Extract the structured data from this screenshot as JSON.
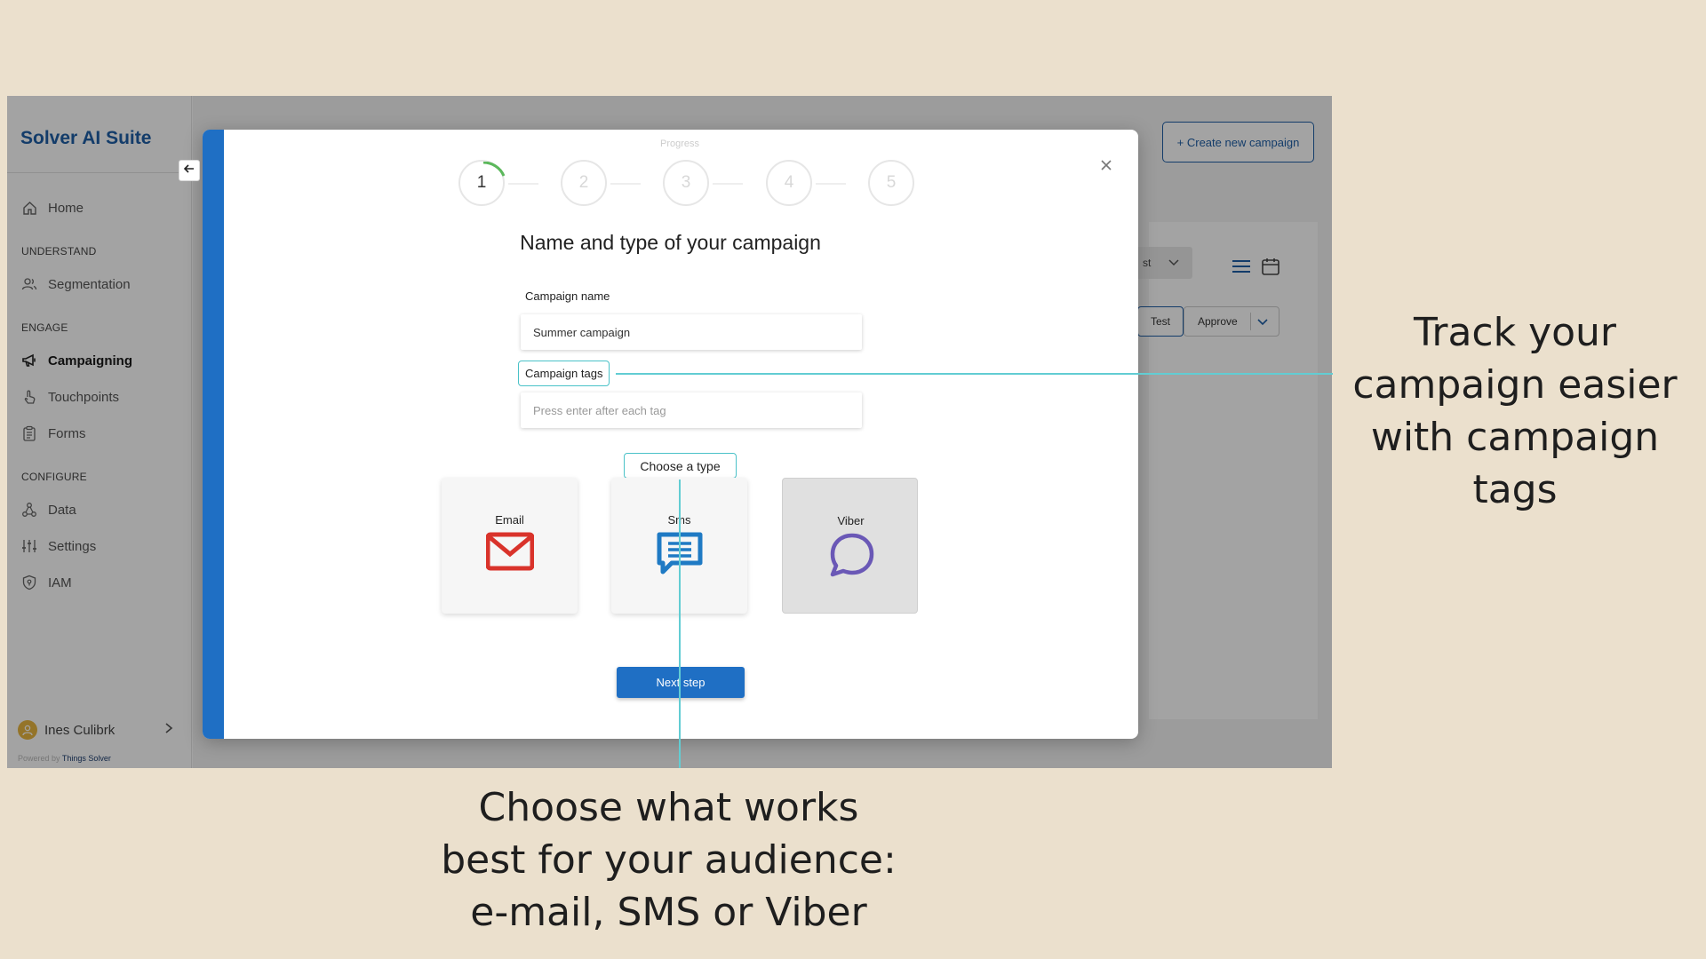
{
  "app": {
    "brand": "Solver AI Suite",
    "create_button": "+ Create new campaign"
  },
  "sidebar": {
    "items": [
      {
        "label": "Home",
        "icon": "home-icon"
      },
      {
        "label": "Segmentation",
        "icon": "users-icon"
      },
      {
        "label": "Campaigning",
        "icon": "megaphone-icon"
      },
      {
        "label": "Touchpoints",
        "icon": "touch-icon"
      },
      {
        "label": "Forms",
        "icon": "clipboard-icon"
      },
      {
        "label": "Data",
        "icon": "data-nodes-icon"
      },
      {
        "label": "Settings",
        "icon": "sliders-icon"
      },
      {
        "label": "IAM",
        "icon": "shield-icon"
      }
    ],
    "sections": [
      "UNDERSTAND",
      "ENGAGE",
      "CONFIGURE"
    ],
    "active_item": "Campaigning",
    "user_name": "Ines Culibrk",
    "powered_by_prefix": "Powered by",
    "powered_by_name": "Things Solver"
  },
  "background_toolbar": {
    "sort_label": "st",
    "test_label": "Test",
    "approve_label": "Approve"
  },
  "modal": {
    "progress_label": "Progress",
    "steps": [
      "1",
      "2",
      "3",
      "4",
      "5"
    ],
    "current_step": 1,
    "title": "Name and type of your campaign",
    "campaign_name_label": "Campaign name",
    "campaign_name_value": "Summer campaign",
    "campaign_tags_label": "Campaign tags",
    "campaign_tags_placeholder": "Press enter after each tag",
    "choose_type_label": "Choose a type",
    "types": [
      {
        "label": "Email",
        "icon": "envelope-icon",
        "color": "#d9332b"
      },
      {
        "label": "Sms",
        "icon": "chat-icon",
        "color": "#1f7ac4"
      },
      {
        "label": "Viber",
        "icon": "viber-bubble-icon",
        "color": "#6a58b6"
      }
    ],
    "selected_type": "Viber",
    "next_button": "Next step"
  },
  "captions": {
    "right": [
      "Track your",
      "campaign easier",
      "with campaign tags"
    ],
    "bottom": [
      "Choose what works",
      "best for your audience:",
      "e-mail, SMS or Viber"
    ]
  },
  "colors": {
    "brand_blue": "#1f6fc4",
    "annotation": "#62cdd3",
    "background": "#ebe0cd"
  }
}
